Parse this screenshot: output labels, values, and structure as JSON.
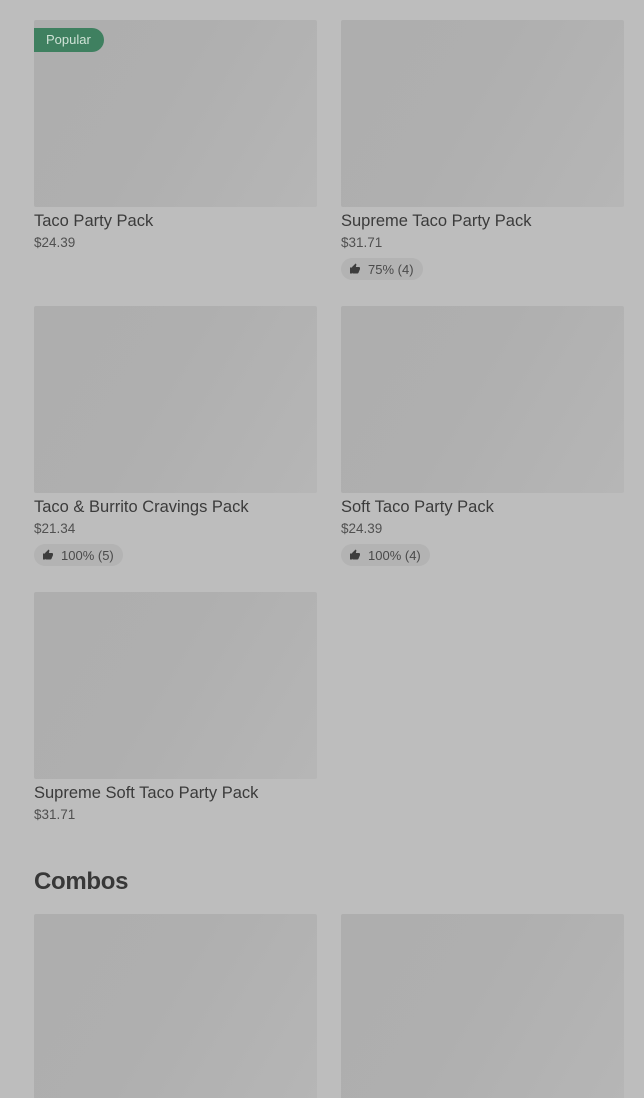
{
  "party_packs": [
    {
      "name": "Taco Party Pack",
      "price": "$24.39",
      "badge": "Popular",
      "rating": ""
    },
    {
      "name": "Supreme Taco Party Pack",
      "price": "$31.71",
      "badge": "",
      "rating": "75% (4)"
    },
    {
      "name": "Taco & Burrito Cravings Pack",
      "price": "$21.34",
      "badge": "",
      "rating": "100% (5)"
    },
    {
      "name": "Soft Taco Party Pack",
      "price": "$24.39",
      "badge": "",
      "rating": "100% (4)"
    },
    {
      "name": "Supreme Soft Taco Party Pack",
      "price": "$31.71",
      "badge": "",
      "rating": ""
    }
  ],
  "combos": {
    "title": "Combos"
  },
  "icons": {
    "rating": "thumbs-up-icon"
  },
  "colors": {
    "background": "#bdbdbd",
    "popular_badge": "#3f8060",
    "rating_pill": "#b3b3b3"
  }
}
